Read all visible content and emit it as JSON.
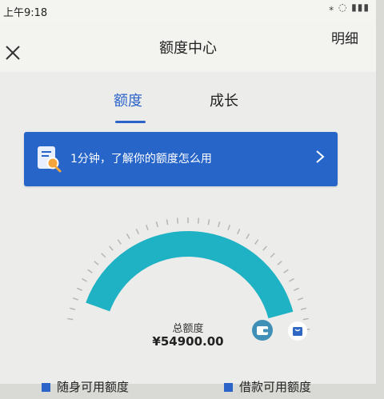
{
  "status_bar": {
    "time": "上午9:18",
    "icons_text": "⁎ ◌ ▮▮▮"
  },
  "nav": {
    "title": "额度中心",
    "detail_link": "明细"
  },
  "tabs": [
    {
      "label": "额度",
      "active": true
    },
    {
      "label": "成长",
      "active": false
    }
  ],
  "banner": {
    "text": "1分钟，了解你的额度怎么用",
    "icon": "document-search-icon"
  },
  "gauge": {
    "label": "总额度",
    "value": "¥54900.00",
    "fill_fraction": 1.0,
    "color": "#1fb2c4"
  },
  "legend": {
    "left_label": "随身可用额度",
    "right_label": "借款可用额度"
  },
  "colors": {
    "accent": "#2b63c8",
    "banner": "#2765c9",
    "gauge": "#1fb2c4",
    "wallet_badge": "#3f8fb6",
    "bag_badge": "#2f67c4"
  }
}
